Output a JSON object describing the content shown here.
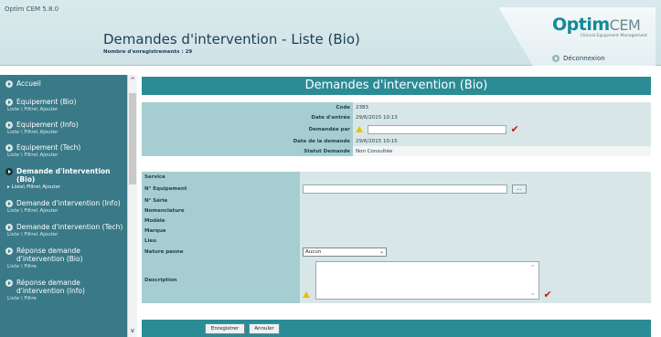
{
  "header": {
    "app_version": "Optim CEM 5.8.0",
    "page_title": "Demandes d'intervention - Liste (Bio)",
    "record_count": "Nombre d'enregistrements : 29",
    "logo_main": "Optim",
    "logo_cem": "CEM",
    "logo_sub": "Clinical Equipment Management",
    "logout": "Déconnexion"
  },
  "sidebar": {
    "items": [
      {
        "label": "Accueil",
        "links": ""
      },
      {
        "label": "Equipement (Bio)",
        "links": "Liste \\ Filtre\\ Ajouter"
      },
      {
        "label": "Equipement (Info)",
        "links": "Liste \\ Filtre\\ Ajouter"
      },
      {
        "label": "Equipement (Tech)",
        "links": "Liste \\ Filtre\\ Ajouter"
      },
      {
        "label": "Demande d'intervention (Bio)",
        "links": "▸ Liste\\ Filtre\\ Ajouter"
      },
      {
        "label": "Demande d'intervention (Info)",
        "links": "Liste \\ Filtre\\ Ajouter"
      },
      {
        "label": "Demande d'intervention (Tech)",
        "links": "Liste \\ Filtre\\ Ajouter"
      },
      {
        "label": "Réponse demande d'intervention (Bio)",
        "links": "Liste \\ Filtre"
      },
      {
        "label": "Réponse demande d'intervention (Info)",
        "links": "Liste \\ Filtre"
      }
    ]
  },
  "form": {
    "banner": "Demandes d'intervention (Bio)",
    "top_fields": [
      {
        "label": "Code",
        "value": "2383"
      },
      {
        "label": "Date d'entrée",
        "value": "29/6/2015 10:13"
      },
      {
        "label": "Demandée par",
        "value": ""
      },
      {
        "label": "Date de la demande",
        "value": "29/6/2015 10:15"
      },
      {
        "label": "Statut Demande",
        "value": "Non Consultée"
      }
    ],
    "bottom_fields": {
      "service": "Service",
      "n_equipement": "N° Equipement",
      "n_serie": "N° Série",
      "nomenclature": "Nomenclature",
      "modele": "Modèle",
      "marque": "Marque",
      "lieu": "Lieu",
      "nature_panne": "Nature panne",
      "nature_panne_value": "Aucun",
      "description": "Description"
    },
    "dots_label": "...",
    "save_label": "Enregistrer",
    "cancel_label": "Annuler"
  },
  "colors": {
    "sidebar_bg": "#3a7987",
    "banner_bg": "#2b8c95",
    "label_bg": "#a6cdd0",
    "value_bg": "#d9e6e8",
    "required_check": "#c41a1a"
  }
}
